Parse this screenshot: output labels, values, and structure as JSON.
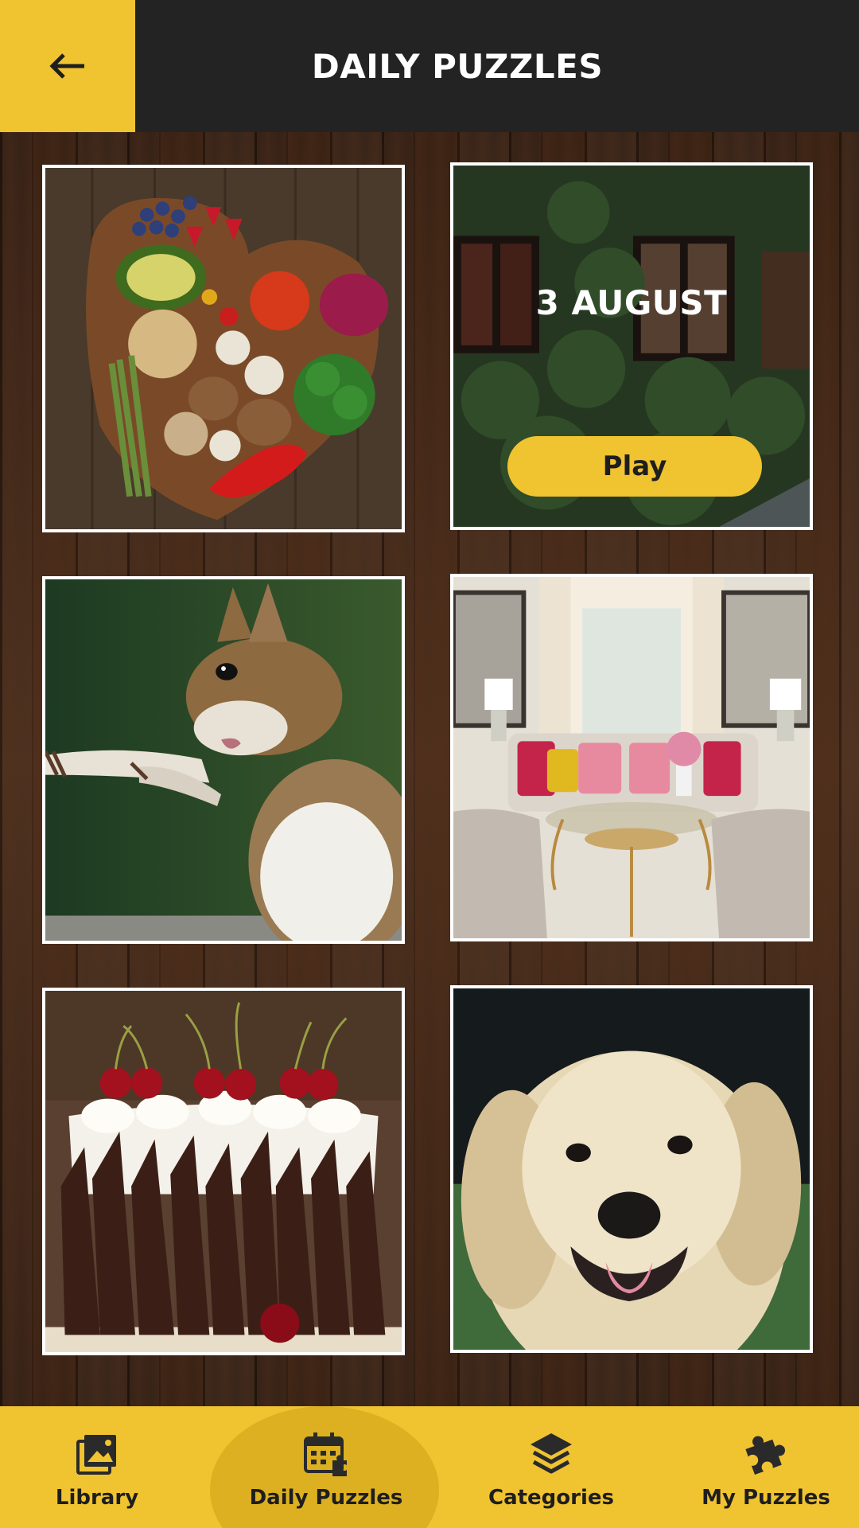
{
  "header": {
    "title": "DAILY PUZZLES",
    "back_icon": "arrow-left-icon"
  },
  "puzzles": [
    {
      "image": "healthy-food-heart-board"
    },
    {
      "image": "ivy-covered-house",
      "date": "3 AUGUST",
      "action": "Play"
    },
    {
      "image": "squirrel"
    },
    {
      "image": "living-room-interior"
    },
    {
      "image": "black-forest-cherry-cake"
    },
    {
      "image": "golden-retriever"
    }
  ],
  "bottom_nav": {
    "items": [
      {
        "label": "Library",
        "icon": "images-icon"
      },
      {
        "label": "Daily Puzzles",
        "icon": "calendar-puzzle-icon",
        "active": true
      },
      {
        "label": "Categories",
        "icon": "layers-icon"
      },
      {
        "label": "My Puzzles",
        "icon": "puzzle-piece-icon"
      }
    ]
  },
  "colors": {
    "accent": "#f0c330",
    "header_bg": "#232323",
    "nav_active_bg": "#dcb021"
  }
}
